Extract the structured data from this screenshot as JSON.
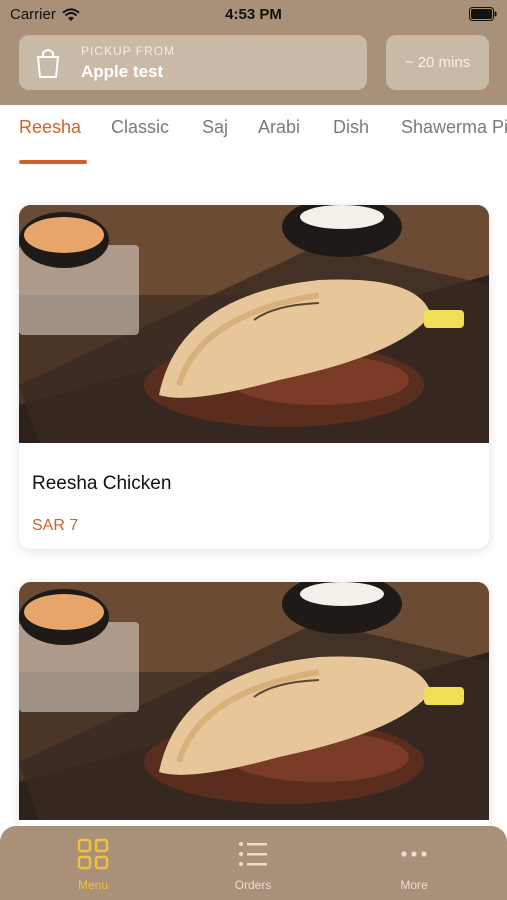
{
  "status_bar": {
    "carrier": "Carrier",
    "time": "4:53 PM"
  },
  "header": {
    "pickup_label": "PICKUP FROM",
    "pickup_location": "Apple test",
    "eta": "~ 20 mins"
  },
  "tabs": [
    {
      "label": "Reesha",
      "active": true
    },
    {
      "label": "Classic",
      "active": false
    },
    {
      "label": "Saj",
      "active": false
    },
    {
      "label": "Arabi",
      "active": false
    },
    {
      "label": "Dish",
      "active": false
    },
    {
      "label": "Shawerma Pi",
      "active": false
    }
  ],
  "products": [
    {
      "name": "Reesha Chicken",
      "price": "SAR 7"
    }
  ],
  "bottom_nav": [
    {
      "label": "Menu",
      "icon": "grid-icon",
      "active": true
    },
    {
      "label": "Orders",
      "icon": "list-icon",
      "active": false
    },
    {
      "label": "More",
      "icon": "more-dots-icon",
      "active": false
    }
  ],
  "colors": {
    "header_bg": "#a89079",
    "accent": "#d2602a",
    "active_nav": "#f3bf3f"
  }
}
